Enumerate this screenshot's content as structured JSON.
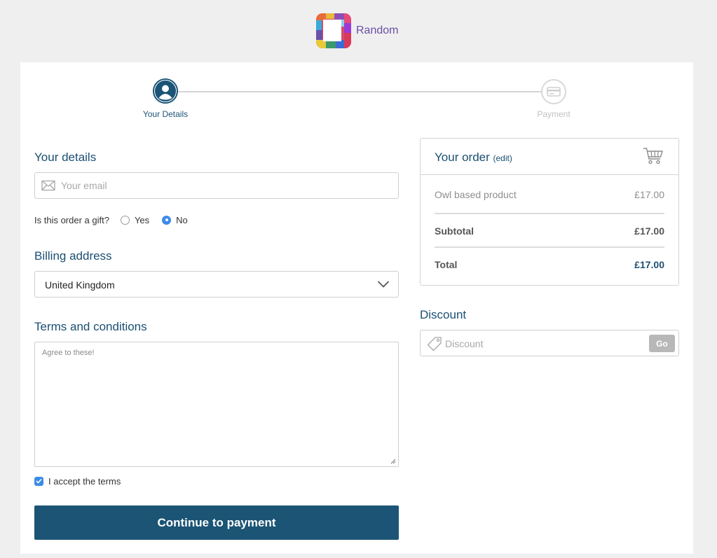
{
  "brand": {
    "name": "Random"
  },
  "stepper": {
    "steps": [
      {
        "label": "Your Details",
        "state": "active"
      },
      {
        "label": "Payment",
        "state": "inactive"
      }
    ]
  },
  "details": {
    "title": "Your details",
    "email_placeholder": "Your email",
    "gift_question": "Is this order a gift?",
    "gift_options": [
      "Yes",
      "No"
    ],
    "gift_selected": "No"
  },
  "billing": {
    "title": "Billing address",
    "country": "United Kingdom"
  },
  "terms": {
    "title": "Terms and conditions",
    "text": "Agree to these!",
    "accept_label": "I accept the terms",
    "accepted": true
  },
  "continue_label": "Continue to payment",
  "order": {
    "title": "Your order",
    "edit_label": "(edit)",
    "items": [
      {
        "name": "Owl based product",
        "price": "£17.00"
      }
    ],
    "subtotal_label": "Subtotal",
    "subtotal": "£17.00",
    "total_label": "Total",
    "total": "£17.00"
  },
  "discount": {
    "title": "Discount",
    "placeholder": "Discount",
    "go_label": "Go"
  },
  "colors": {
    "primary": "#1b5475",
    "heading": "#1b4f72",
    "brand": "#6b4fa8",
    "radio_checked": "#3c8be8",
    "background": "#efefef"
  }
}
